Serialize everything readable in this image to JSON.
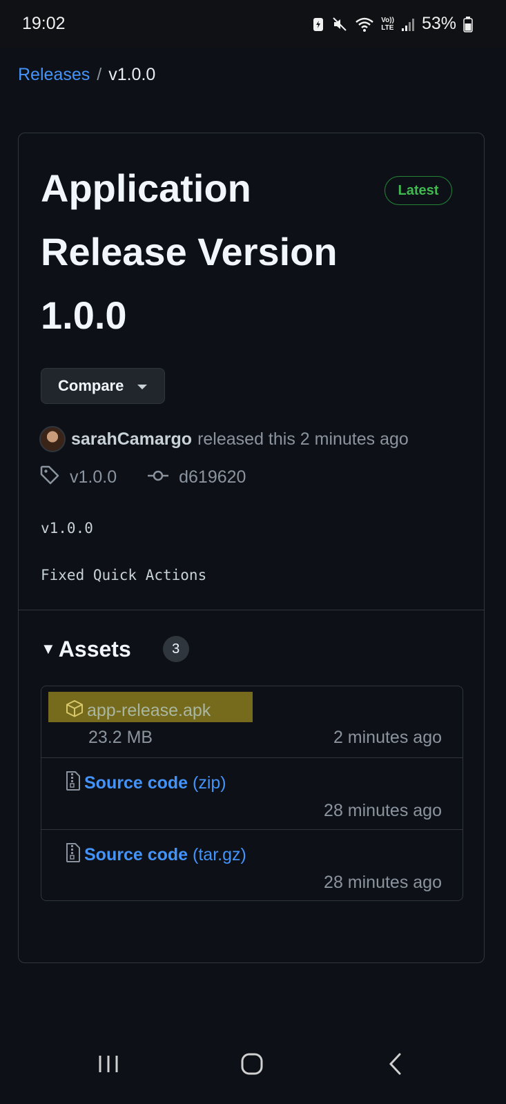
{
  "status_bar": {
    "time": "19:02",
    "battery_percent": "53%",
    "network_label": "LTE",
    "volte_label": "Vo))"
  },
  "breadcrumb": {
    "parent": "Releases",
    "separator": "/",
    "current": "v1.0.0"
  },
  "release": {
    "title": "Application Release Version 1.0.0",
    "badge": "Latest",
    "compare_label": "Compare",
    "author": "sarahCamargo",
    "released_text": "released this 2 minutes ago",
    "tag": "v1.0.0",
    "commit": "d619620",
    "notes": [
      "v1.0.0",
      "Fixed Quick Actions"
    ]
  },
  "assets": {
    "title": "Assets",
    "count": "3",
    "items": [
      {
        "name": "app-release.apk",
        "size": "23.2 MB",
        "time": "2 minutes ago",
        "icon": "package-icon"
      },
      {
        "name": "Source code",
        "suffix": "(zip)",
        "time": "28 minutes ago",
        "icon": "file-zip-icon"
      },
      {
        "name": "Source code",
        "suffix": "(tar.gz)",
        "time": "28 minutes ago",
        "icon": "file-zip-icon"
      }
    ]
  },
  "nav_bar": {
    "buttons": [
      "recent-apps-icon",
      "home-icon",
      "back-icon"
    ]
  },
  "colors": {
    "background": "#0d1117",
    "link": "#4493f8",
    "latest_green": "#3fb950",
    "highlight": "#8a7a1e"
  }
}
